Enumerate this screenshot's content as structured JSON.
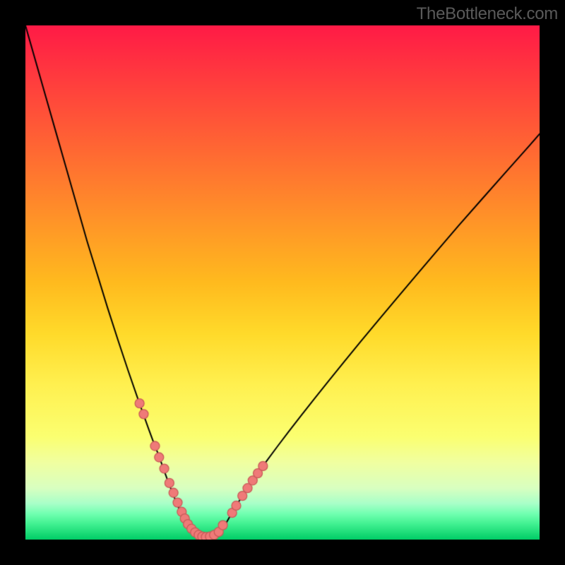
{
  "watermark": "TheBottleneck.com",
  "chart_data": {
    "type": "line",
    "title": "",
    "xlabel": "",
    "ylabel": "",
    "xlim": [
      0,
      100
    ],
    "ylim": [
      0,
      100
    ],
    "series": [
      {
        "name": "left-curve",
        "x": [
          0,
          2,
          4,
          6,
          8,
          10,
          12,
          14,
          16,
          18,
          20,
          22,
          24,
          25,
          26,
          26.8,
          27.6,
          28.4,
          29.2,
          30.0,
          30.8,
          31.5
        ],
        "y": [
          100,
          93,
          86,
          79,
          72,
          65,
          58,
          51.5,
          45,
          38.8,
          32.8,
          27,
          21.4,
          18.7,
          16.2,
          13.9,
          11.7,
          9.6,
          7.6,
          5.7,
          3.9,
          2.2
        ]
      },
      {
        "name": "right-curve",
        "x": [
          38.5,
          39.2,
          40,
          41,
          42.2,
          43.6,
          45.2,
          47,
          49,
          51.2,
          53.6,
          56.2,
          59,
          62,
          65.2,
          68.6,
          72.2,
          76,
          80,
          84.2,
          88.6,
          93.2,
          98,
          100
        ],
        "y": [
          2.2,
          3.5,
          4.9,
          6.6,
          8.5,
          10.6,
          12.9,
          15.4,
          18.1,
          21,
          24.1,
          27.4,
          30.9,
          34.6,
          38.5,
          42.6,
          46.9,
          51.4,
          56.1,
          61,
          66,
          71.2,
          76.6,
          78.9
        ]
      },
      {
        "name": "valley-floor",
        "x": [
          31.5,
          32.5,
          33.5,
          34.5,
          35.5,
          36.5,
          37.5,
          38.5
        ],
        "y": [
          2.2,
          1.2,
          0.6,
          0.25,
          0.25,
          0.6,
          1.2,
          2.2
        ]
      }
    ],
    "dots_left": {
      "name": "left-dots",
      "x": [
        22.2,
        23.0,
        25.2,
        26.0,
        27.0,
        28.0,
        28.8,
        29.6,
        30.4,
        31.0,
        31.6,
        32.3,
        33.0,
        33.7,
        34.4,
        35.1,
        35.9,
        36.7
      ],
      "y": [
        26.5,
        24.4,
        18.2,
        16.0,
        13.8,
        11.0,
        9.1,
        7.2,
        5.4,
        4.1,
        3.0,
        2.1,
        1.4,
        0.9,
        0.6,
        0.5,
        0.6,
        0.9
      ]
    },
    "dots_right": {
      "name": "right-dots",
      "x": [
        37.6,
        38.4,
        40.2,
        41.0,
        42.2,
        43.2,
        44.2,
        45.2,
        46.2
      ],
      "y": [
        1.5,
        2.8,
        5.2,
        6.6,
        8.5,
        10.0,
        11.5,
        12.9,
        14.3
      ]
    },
    "dot_color": "#ef7a78",
    "dot_stroke": "#c95a58",
    "curve_color": "#000000",
    "curve_width": 2.0,
    "dot_radius": 6.5
  }
}
